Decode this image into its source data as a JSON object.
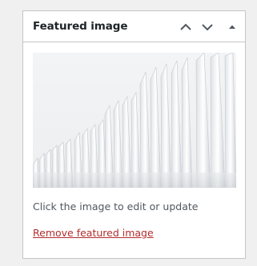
{
  "panel": {
    "title": "Featured image",
    "controls": {
      "move_up_icon": "chevron-up-icon",
      "move_down_icon": "chevron-down-icon",
      "toggle_icon": "triangle-up-icon"
    }
  },
  "image": {
    "icon": "featured-image-thumbnail"
  },
  "hint": "Click the image to edit or update",
  "remove_link": "Remove featured image",
  "colors": {
    "background": "#f0f0f1",
    "panel_border": "#c3c4c7",
    "title": "#1d2327",
    "hint_text": "#50575e",
    "remove_link": "#b32d2e",
    "icon": "#50575e"
  }
}
